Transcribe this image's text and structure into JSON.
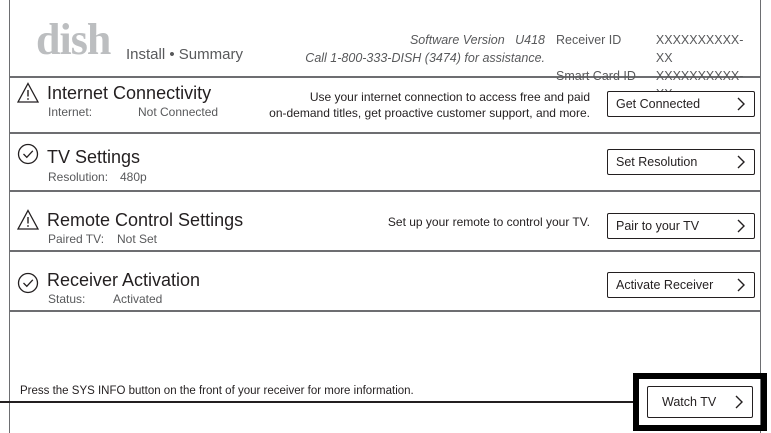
{
  "header": {
    "logo_text": "dish",
    "title": "Install • Summary",
    "software_label": "Software Version",
    "software_version": "U418",
    "assistance_text": "Call 1-800-333-DISH (3474) for assistance.",
    "receiver_id_label": "Receiver ID",
    "receiver_id_value": "XXXXXXXXXX-XX",
    "smart_card_label": "Smart Card ID",
    "smart_card_value": "XXXXXXXXXX-XX"
  },
  "rows": [
    {
      "status_icon": "warning-icon",
      "title": "Internet Connectivity",
      "sub_label": "Internet:",
      "sub_value": "Not Connected",
      "desc_line1": "Use your internet connection to access free and paid",
      "desc_line2": "on-demand titles, get proactive customer support, and more.",
      "button": "Get Connected"
    },
    {
      "status_icon": "check-circle-icon",
      "title": "TV Settings",
      "sub_label": "Resolution:",
      "sub_value": "480p",
      "button": "Set Resolution"
    },
    {
      "status_icon": "warning-icon",
      "title": "Remote Control Settings",
      "sub_label": "Paired TV:",
      "sub_value": "Not Set",
      "desc_line1": "Set up your remote to control your TV.",
      "button": "Pair to your TV"
    },
    {
      "status_icon": "check-circle-icon",
      "title": "Receiver Activation",
      "sub_label": "Status:",
      "sub_value": "Activated",
      "button": "Activate Receiver"
    }
  ],
  "footer": {
    "info_text": "Press the SYS INFO button on the front of your receiver for more information.",
    "watch_button": "Watch TV"
  },
  "colors": {
    "text": "#231f20",
    "muted": "#58595b",
    "logo": "#bcbec0",
    "rule": "#6d6e71",
    "highlight": "#000000"
  }
}
